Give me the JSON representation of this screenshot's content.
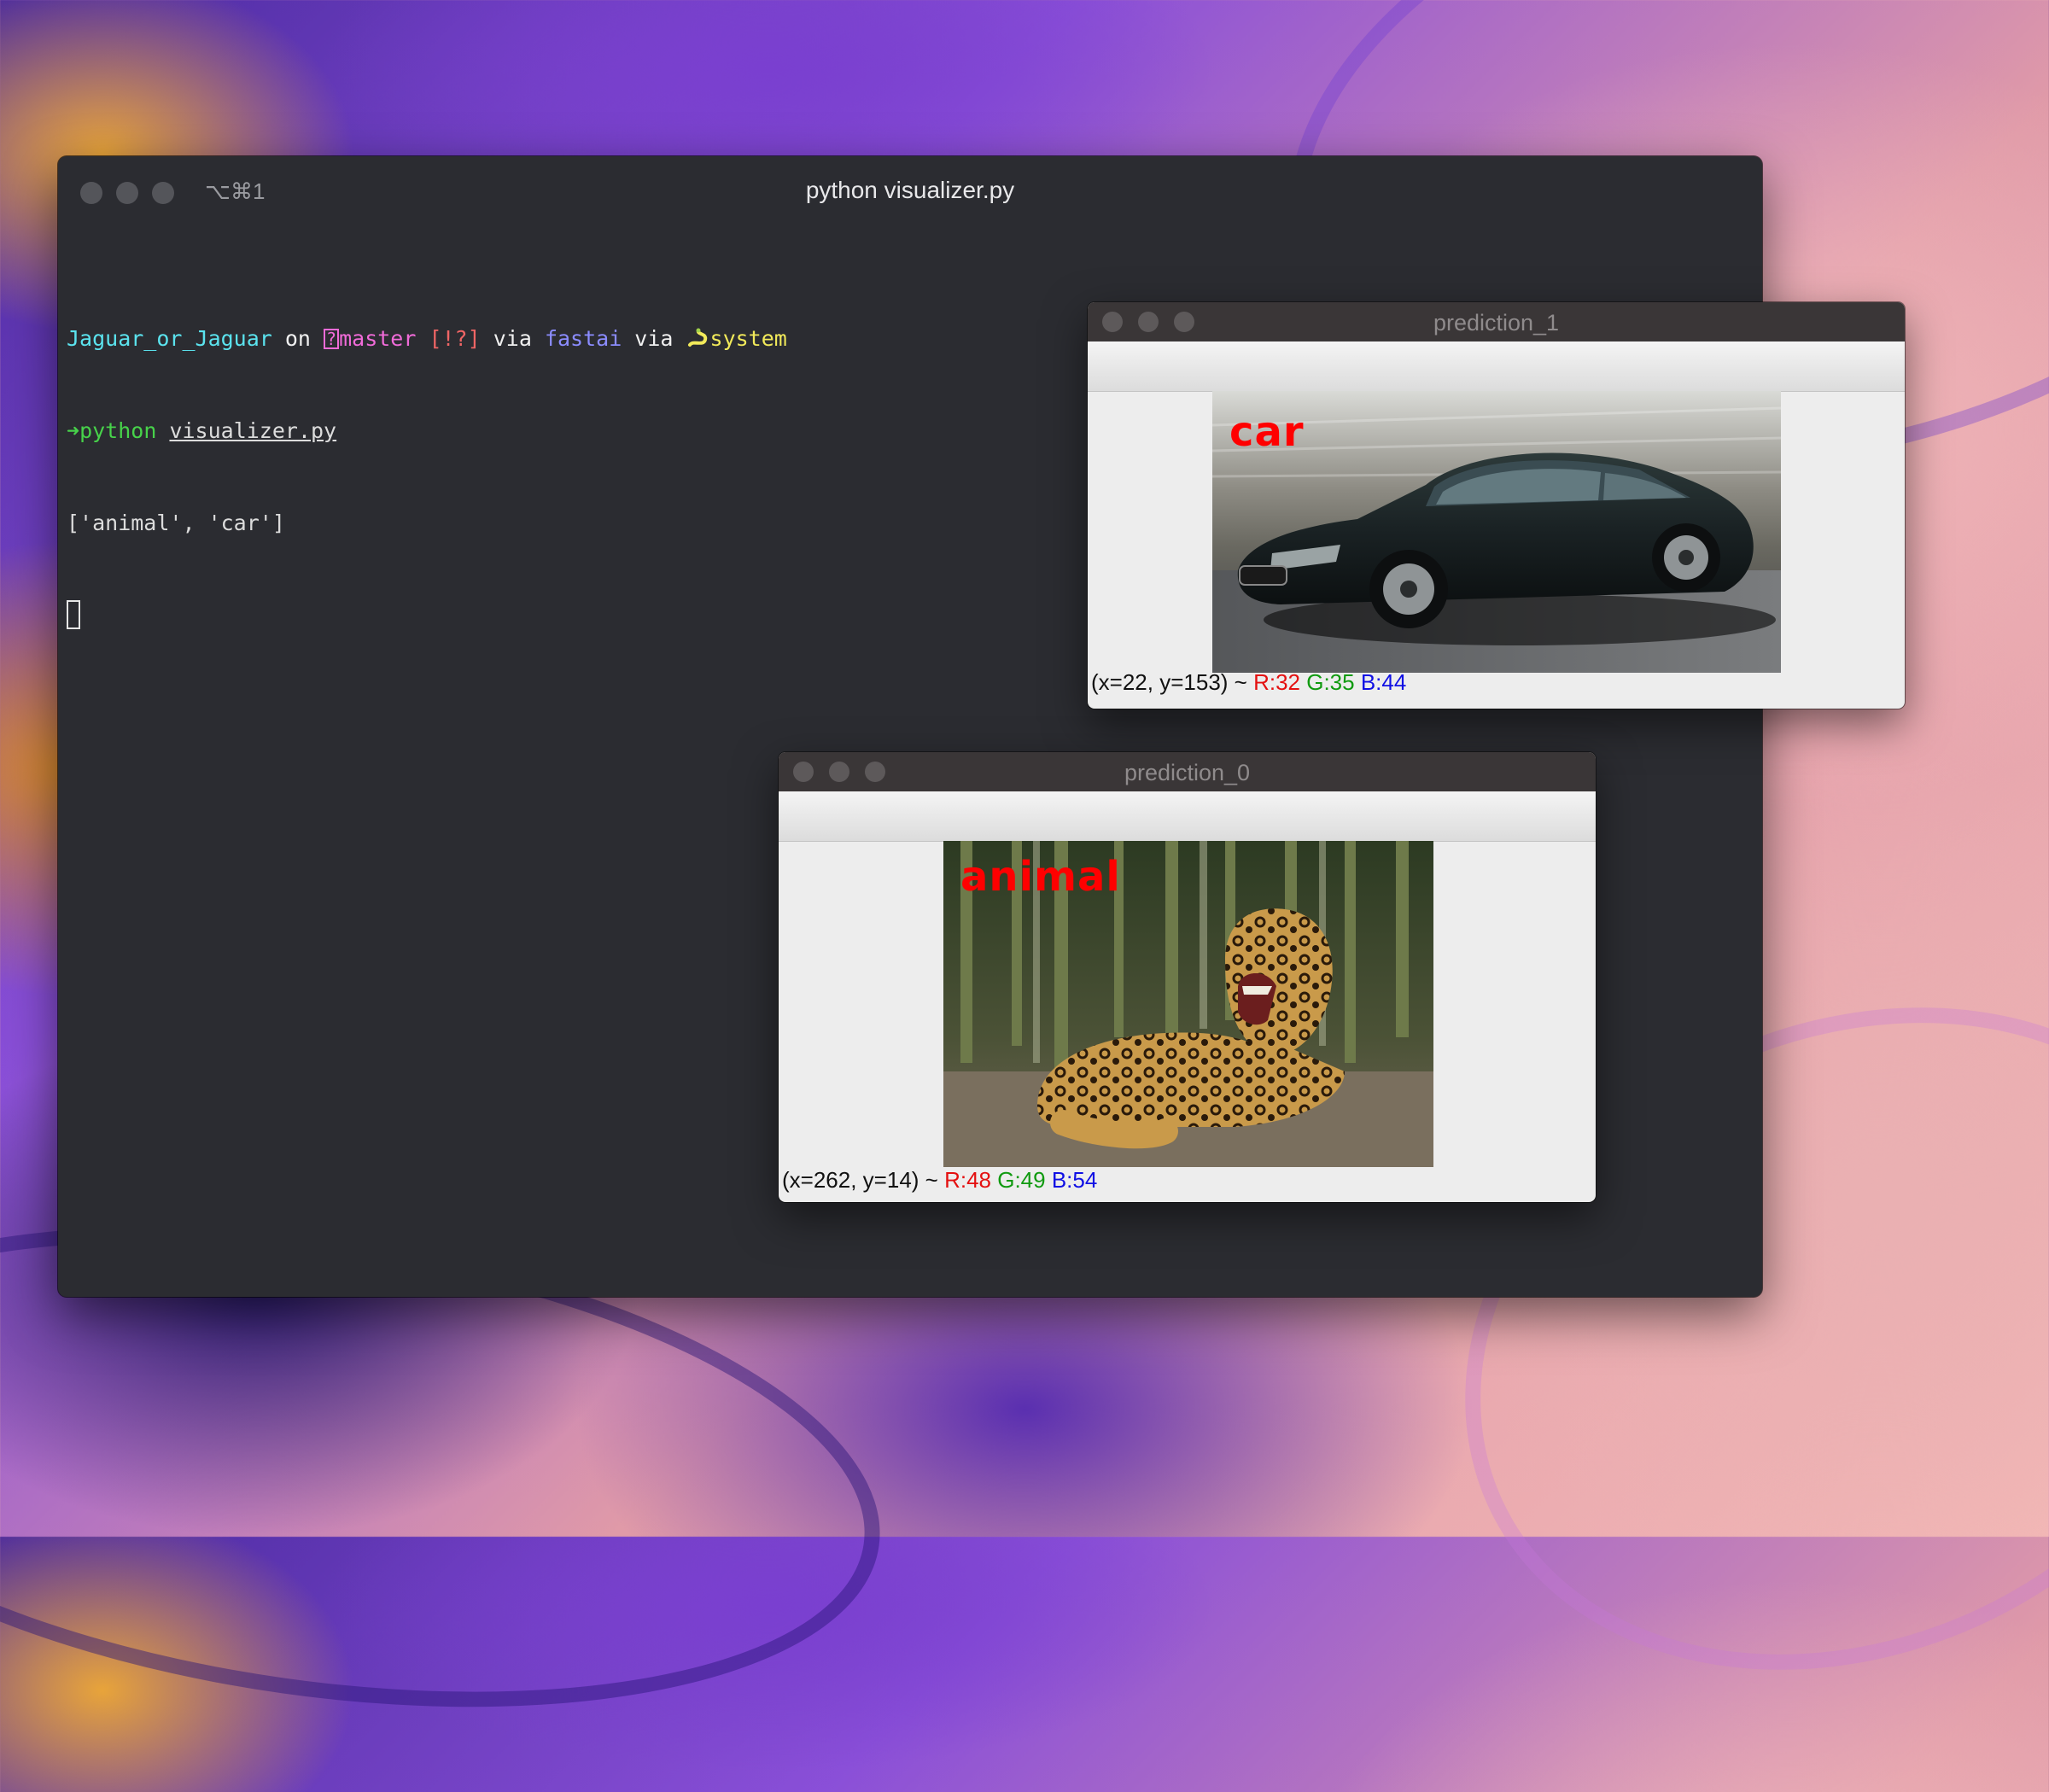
{
  "terminal": {
    "shortcut": "⌥⌘1",
    "title": "python visualizer.py",
    "prompt": {
      "dir": "Jaguar_or_Jaguar",
      "on": " on ",
      "git_icon": "?",
      "branch": "master",
      "status": " [!?]",
      "via1": " via ",
      "env": "fastai",
      "via2": " via ",
      "python_icon": "python-snake-icon",
      "python_version": "system"
    },
    "command_arrow": "➜",
    "command": "python",
    "command_arg": "visualizer.py",
    "output": "['animal', 'car']"
  },
  "windows": [
    {
      "title": "prediction_1",
      "label": "car",
      "status_prefix": "(x=22, y=153) ~ ",
      "r": "R:32",
      "g": "G:35",
      "b": "B:44"
    },
    {
      "title": "prediction_0",
      "label": "animal",
      "status_prefix": "(x=262, y=14) ~ ",
      "r": "R:48",
      "g": "G:49",
      "b": "B:54"
    }
  ]
}
